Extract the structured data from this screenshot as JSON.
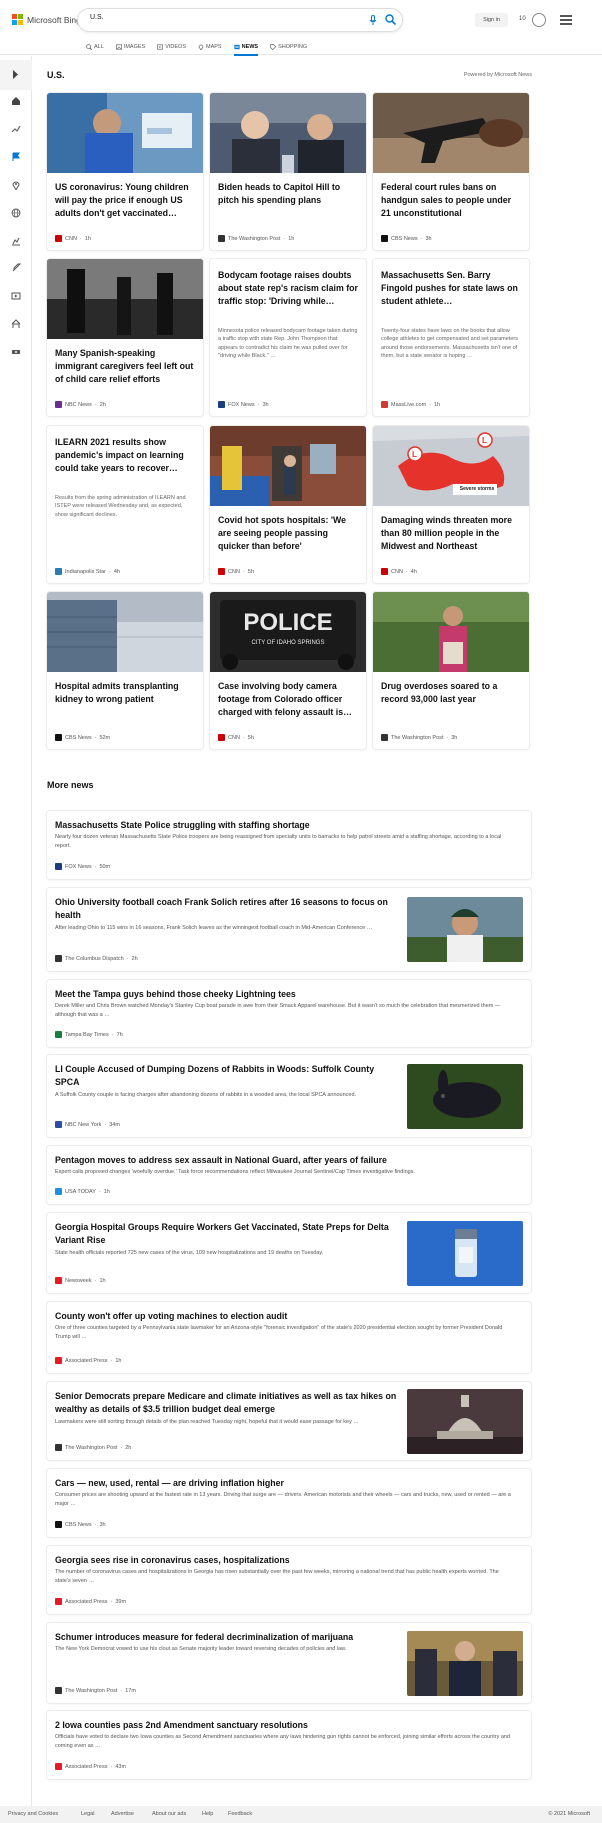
{
  "brand": {
    "name": "Microsoft Bing"
  },
  "search": {
    "query": "U.S."
  },
  "header": {
    "signin_label": "Sign in",
    "rewards_count": "10"
  },
  "tabs": [
    {
      "label": "ALL",
      "icon": "search-icon"
    },
    {
      "label": "IMAGES",
      "icon": "image-icon"
    },
    {
      "label": "VIDEOS",
      "icon": "video-icon"
    },
    {
      "label": "MAPS",
      "icon": "map-pin-icon"
    },
    {
      "label": "NEWS",
      "icon": "news-icon",
      "active": true
    },
    {
      "label": "SHOPPING",
      "icon": "tag-icon"
    }
  ],
  "sidebar": {
    "icons": [
      "home-icon",
      "trending-icon",
      "flag-icon",
      "location-icon",
      "globe-icon",
      "business-icon",
      "rocket-icon",
      "entertainment-icon",
      "sports-icon",
      "money-icon"
    ]
  },
  "section": {
    "title": "U.S.",
    "powered": "Powered by Microsoft News"
  },
  "cards": [
    {
      "title": "US coronavirus: Young children will pay the price if enough US adults don't get vaccinated…",
      "source": "CNN",
      "time": "1h",
      "has_image": true,
      "source_color": "#cc0000",
      "image": "vaccine-photo"
    },
    {
      "title": "Biden heads to Capitol Hill to pitch his spending plans",
      "source": "The Washington Post",
      "time": "1h",
      "has_image": true,
      "source_color": "#333333",
      "image": "senators-photo"
    },
    {
      "title": "Federal court rules bans on handgun sales to people under 21 unconstitutional",
      "source": "CBS News",
      "time": "3h",
      "has_image": true,
      "source_color": "#111111",
      "image": "handgun-photo"
    },
    {
      "title": "Many Spanish-speaking immigrant caregivers feel left out of child care relief efforts",
      "source": "NBC News",
      "time": "2h",
      "has_image": true,
      "source_color": "#6a2c91",
      "image": "silhouette-photo"
    },
    {
      "title": "Bodycam footage raises doubts about state rep's racism claim for traffic stop: 'Driving while…",
      "snippet": "Minnesota police released bodycam footage taken during a traffic stop with state Rep. John Thompson that appears to contradict his claim he was pulled over for \"driving while Black.\" …",
      "source": "FOX News",
      "time": "3h",
      "has_image": false,
      "source_color": "#1a3d7c"
    },
    {
      "title": "Massachusetts Sen. Barry Fingold pushes for state laws on student athlete…",
      "snippet": "Twenty-four states have laws on the books that allow college athletes to get compensated and set parameters around those endorsements. Massachusetts isn't one of them, but a state senator is hoping …",
      "source": "MassLive.com",
      "time": "1h",
      "has_image": false,
      "source_color": "#d23b2f"
    },
    {
      "title": "ILEARN 2021 results show pandemic's impact on learning could take years to recover…",
      "snippet": "Results from the spring administration of ILEARN and ISTEP were released Wednesday and, as expected, show significant declines.",
      "source": "Indianapolis Star",
      "time": "4h",
      "has_image": false,
      "source_color": "#2a7ab8"
    },
    {
      "title": "Covid hot spots hospitals: 'We are seeing people passing quicker than before'",
      "source": "CNN",
      "time": "5h",
      "has_image": true,
      "source_color": "#cc0000",
      "image": "hospital-photo"
    },
    {
      "title": "Damaging winds threaten more than 80 million people in the Midwest and Northeast",
      "source": "CNN",
      "time": "4h",
      "has_image": true,
      "source_color": "#cc0000",
      "image": "weather-map",
      "image_label": "Severe storms"
    },
    {
      "title": "Hospital admits transplanting kidney to wrong patient",
      "source": "CBS News",
      "time": "52m",
      "has_image": true,
      "source_color": "#111111",
      "image": "building-photo"
    },
    {
      "title": "Case involving body camera footage from Colorado officer charged with felony assault is…",
      "source": "CNN",
      "time": "5h",
      "has_image": true,
      "source_color": "#cc0000",
      "image": "police-photo",
      "image_label": "POLICE",
      "image_sublabel": "CITY OF IDAHO SPRINGS"
    },
    {
      "title": "Drug overdoses soared to a record 93,000 last year",
      "source": "The Washington Post",
      "time": "3h",
      "has_image": true,
      "source_color": "#333333",
      "image": "woman-photo"
    }
  ],
  "more_news": {
    "title": "More news",
    "items": [
      {
        "title": "Massachusetts State Police struggling with staffing shortage",
        "snippet": "Nearly four dozen veteran Massachusetts State Police troopers are being reassigned from specialty units to barracks to help patrol streets amid a staffing shortage, according to a local report.",
        "source": "FOX News",
        "time": "50m",
        "source_color": "#1a3d7c"
      },
      {
        "title": "Ohio University football coach Frank Solich retires after 16 seasons to focus on health",
        "snippet": "After leading Ohio to 115 wins in 16 seasons, Frank Solich leaves as the winningest football coach in Mid-American Conference …",
        "source": "The Columbus Dispatch",
        "time": "2h",
        "source_color": "#333333",
        "image": "coach-photo"
      },
      {
        "title": "Meet the Tampa guys behind those cheeky Lightning tees",
        "snippet": "Derek Miller and Chris Brown watched Monday's Stanley Cup boat parade in awe from their Smack Apparel warehouse. But it wasn't so much the celebration that mesmerized them — although that was a …",
        "source": "Tampa Bay Times",
        "time": "7h",
        "source_color": "#1b7c3f"
      },
      {
        "title": "LI Couple Accused of Dumping Dozens of Rabbits in Woods: Suffolk County SPCA",
        "snippet": "A Suffolk County couple is facing charges after abandoning dozens of rabbits in a wooded area, the local SPCA announced.",
        "source": "NBC New York",
        "time": "34m",
        "source_color": "#2a4fa8",
        "image": "rabbit-photo"
      },
      {
        "title": "Pentagon moves to address sex assault in National Guard, after years of failure",
        "snippet": "Expert calls proposed changes 'woefully overdue.' Task force recommendations reflect Milwaukee Journal Sentinel/Cap Times investigative findings.",
        "source": "USA TODAY",
        "time": "1h",
        "source_color": "#1e90e0"
      },
      {
        "title": "Georgia Hospital Groups Require Workers Get Vaccinated, State Preps for Delta Variant Rise",
        "snippet": "State health officials reported 725 new cases of the virus, 109 new hospitalizations and 19 deaths on Tuesday.",
        "source": "Newsweek",
        "time": "1h",
        "source_color": "#e31b23",
        "image": "vial-photo"
      },
      {
        "title": "County won't offer up voting machines to election audit",
        "snippet": "One of three counties targeted by a Pennsylvania state lawmaker for an Arizona-style \"forensic investigation\" of the state's 2020 presidential election sought by former President Donald Trump will …",
        "source": "Associated Press",
        "time": "1h",
        "source_color": "#e31b23"
      },
      {
        "title": "Senior Democrats prepare Medicare and climate initiatives as well as tax hikes on wealthy as details of $3.5 trillion budget deal emerge",
        "snippet": "Lawmakers were still sorting through details of the plan reached Tuesday night, hopeful that it would ease passage for key …",
        "source": "The Washington Post",
        "time": "2h",
        "source_color": "#333333",
        "image": "capitol-photo"
      },
      {
        "title": "Cars — new, used, rental — are driving inflation higher",
        "snippet": "Consumer prices are shooting upward at the fastest rate in 13 years. Driving that surge are — drivers.  American motorists and their wheels — cars and trucks, new, used or rented — are a major …",
        "source": "CBS News",
        "time": "3h",
        "source_color": "#111111"
      },
      {
        "title": "Georgia sees rise in coronavirus cases, hospitalizations",
        "snippet": "The number of coronavirus cases and hospitalizations in Georgia has risen substantially over the past few weeks, mirroring a national trend that has public health experts worried. The state's seven …",
        "source": "Associated Press",
        "time": "39m",
        "source_color": "#e31b23"
      },
      {
        "title": "Schumer introduces measure for federal decriminalization of marijuana",
        "snippet": "The New York Democrat vowed to use his clout as Senate majority leader toward reversing decades of policies and law.",
        "source": "The Washington Post",
        "time": "17m",
        "source_color": "#333333",
        "image": "schumer-photo"
      },
      {
        "title": "2 Iowa counties pass 2nd Amendment sanctuary resolutions",
        "snippet": "Officials have voted to declare two Iowa counties as Second Amendment sanctuaries where any laws hindering gun rights cannot be enforced, joining similar efforts across the country and coming even as …",
        "source": "Associated Press",
        "time": "43m",
        "source_color": "#e31b23"
      }
    ]
  },
  "footer": {
    "links": [
      "Privacy and Cookies",
      "Legal",
      "Advertise",
      "About our ads",
      "Help",
      "Feedback"
    ],
    "copyright": "© 2021 Microsoft"
  }
}
